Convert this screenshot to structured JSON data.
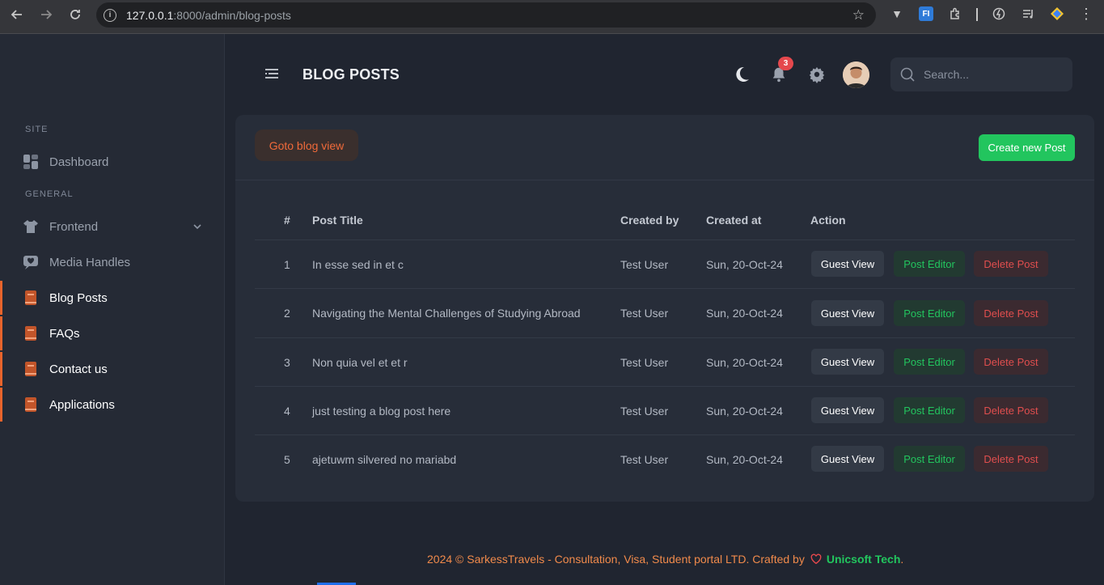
{
  "browser": {
    "url_host": "127.0.0.1",
    "url_rest": ":8000/admin/blog-posts"
  },
  "sidebar": {
    "sections": [
      "SITE",
      "GENERAL"
    ],
    "items": [
      {
        "label": "Dashboard"
      },
      {
        "label": "Frontend"
      },
      {
        "label": "Media Handles"
      },
      {
        "label": "Blog Posts"
      },
      {
        "label": "FAQs"
      },
      {
        "label": "Contact us"
      },
      {
        "label": "Applications"
      }
    ]
  },
  "header": {
    "title": "BLOG POSTS",
    "notification_count": "3",
    "search_placeholder": "Search..."
  },
  "card": {
    "goto_label": "Goto blog view",
    "create_label": "Create new Post"
  },
  "table": {
    "columns": [
      "#",
      "Post Title",
      "Created by",
      "Created at",
      "Action"
    ],
    "actions": {
      "guest": "Guest View",
      "editor": "Post Editor",
      "delete": "Delete Post"
    },
    "rows": [
      {
        "num": "1",
        "title": "In esse sed in et c",
        "created_by": "Test User",
        "created_at": "Sun, 20-Oct-24"
      },
      {
        "num": "2",
        "title": "Navigating the Mental Challenges of Studying Abroad",
        "created_by": "Test User",
        "created_at": "Sun, 20-Oct-24"
      },
      {
        "num": "3",
        "title": "Non quia vel et et r",
        "created_by": "Test User",
        "created_at": "Sun, 20-Oct-24"
      },
      {
        "num": "4",
        "title": "just testing a blog post here",
        "created_by": "Test User",
        "created_at": "Sun, 20-Oct-24"
      },
      {
        "num": "5",
        "title": "ajetuwm silvered no mariabd",
        "created_by": "Test User",
        "created_at": "Sun, 20-Oct-24"
      }
    ]
  },
  "footer": {
    "text": "2024 © SarkessTravels - Consultation, Visa, Student portal LTD. Crafted by",
    "brand": "Unicsoft Tech",
    "end": "."
  },
  "colors": {
    "accent": "#e8642c",
    "success": "#22c55e",
    "danger": "#e04e4e",
    "badge": "#e5484d"
  }
}
